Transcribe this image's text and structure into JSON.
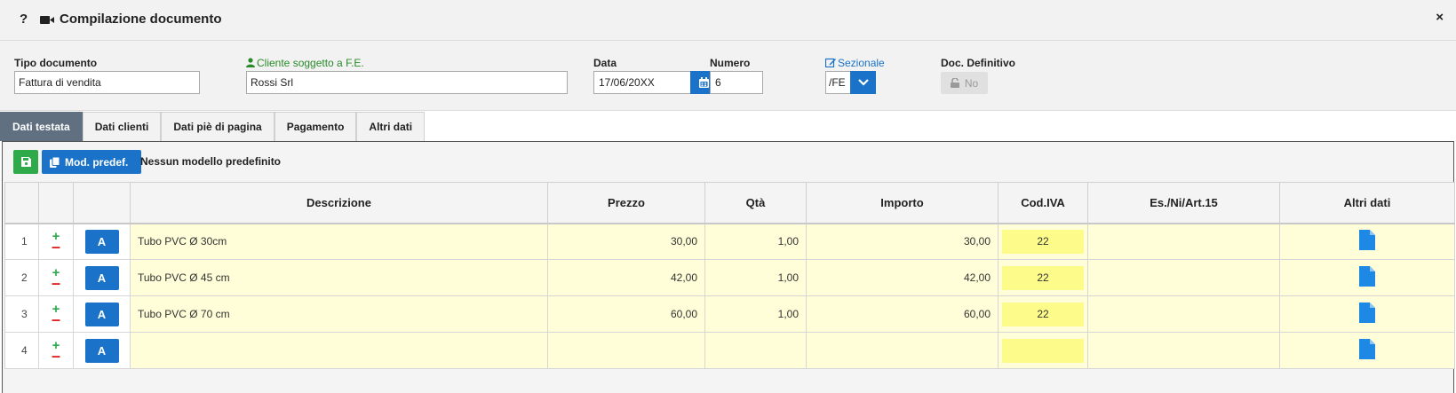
{
  "titlebar": {
    "title": "Compilazione documento",
    "help_icon": "?",
    "close_icon": "×",
    "video_icon": "video-camera-icon"
  },
  "form": {
    "tipo_label": "Tipo documento",
    "tipo_value": "Fattura di vendita",
    "cliente_label": "Cliente soggetto a F.E.",
    "cliente_value": "Rossi Srl",
    "data_label": "Data",
    "data_value": "17/06/20XX",
    "numero_label": "Numero",
    "numero_value": "6",
    "sezionale_label": "Sezionale",
    "sezionale_value": "/FE",
    "definitivo_label": "Doc. Definitivo",
    "definitivo_value": "No"
  },
  "tabs": [
    {
      "label": "Dati testata",
      "active": true
    },
    {
      "label": "Dati clienti",
      "active": false
    },
    {
      "label": "Dati piè di pagina",
      "active": false
    },
    {
      "label": "Pagamento",
      "active": false
    },
    {
      "label": "Altri dati",
      "active": false
    }
  ],
  "toolbar": {
    "mod_label": "Mod. predef.",
    "model_text": "Nessun modello predefinito"
  },
  "table": {
    "headers": [
      "",
      "",
      "",
      "Descrizione",
      "Prezzo",
      "Qtà",
      "Importo",
      "Cod.IVA",
      "Es./Ni/Art.15",
      "Altri dati"
    ],
    "rows": [
      {
        "n": "1",
        "a": "A",
        "desc": "Tubo PVC Ø 30cm",
        "prezzo": "30,00",
        "qta": "1,00",
        "importo": "30,00",
        "iva": "22",
        "es": ""
      },
      {
        "n": "2",
        "a": "A",
        "desc": "Tubo PVC Ø 45 cm",
        "prezzo": "42,00",
        "qta": "1,00",
        "importo": "42,00",
        "iva": "22",
        "es": ""
      },
      {
        "n": "3",
        "a": "A",
        "desc": "Tubo PVC Ø 70 cm",
        "prezzo": "60,00",
        "qta": "1,00",
        "importo": "60,00",
        "iva": "22",
        "es": ""
      },
      {
        "n": "4",
        "a": "A",
        "desc": "",
        "prezzo": "",
        "qta": "",
        "importo": "",
        "iva": "",
        "es": ""
      }
    ]
  },
  "colors": {
    "accent": "#1a73c8",
    "save_green": "#2eaa4a",
    "row_bg": "#fffed8",
    "iva_bg": "#fdfc8a",
    "active_tab": "#607080"
  }
}
